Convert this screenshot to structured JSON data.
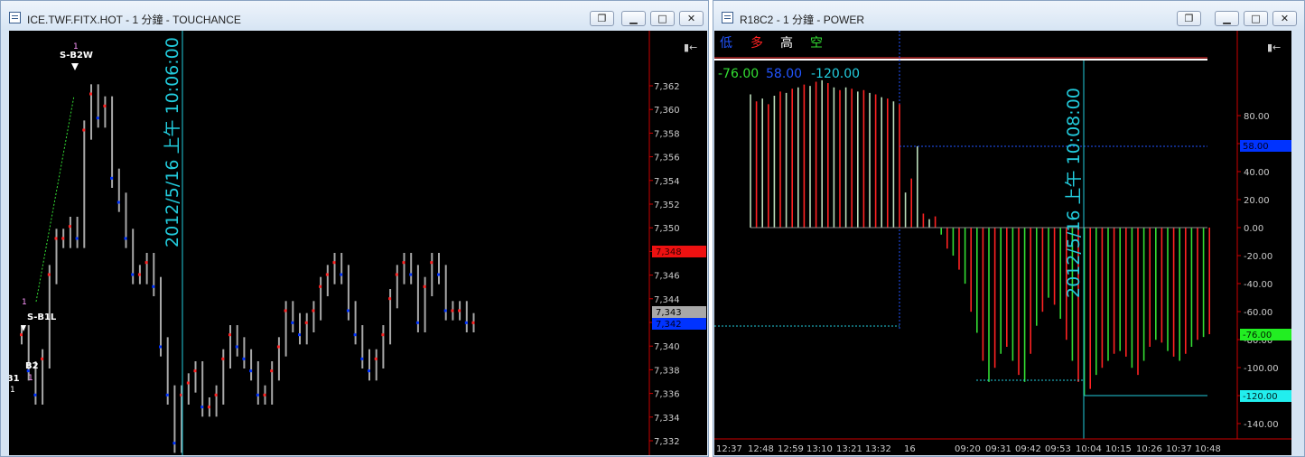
{
  "colors": {
    "bg": "#000000",
    "up": "#ff2222",
    "down": "#0033ff",
    "bar": "#a8a8a8",
    "cursor": "#22ccdd",
    "green": "#33dd33",
    "axis": "#cc0000"
  },
  "icons": {
    "window": "window-icon",
    "restore": "restore-icon",
    "minimize": "minimize-icon",
    "maximize": "maximize-icon",
    "close": "close-icon",
    "collapse": "collapse-icon"
  },
  "left_window": {
    "title": "ICE.TWF.FITX.HOT - 1 分鐘 - TOUCHANCE",
    "cursor_label": "2012/5/16 上午 10:06:00",
    "y_ticks": [
      "7,362",
      "7,360",
      "7,358",
      "7,356",
      "7,354",
      "7,352",
      "7,350",
      "7,348",
      "7,346",
      "7,344",
      "7,342",
      "7,340",
      "7,338",
      "7,336",
      "7,334",
      "7,332"
    ],
    "tag_red": "7,348",
    "tag_gray": "7,343",
    "tag_blue": "7,342",
    "marks": {
      "s_b2w": "S-B2W",
      "s_b1l": "S-B1L",
      "b2": "B2",
      "b1": "B1",
      "one": "1"
    }
  },
  "right_window": {
    "title": "R18C2 - 1 分鐘 - POWER",
    "legend": [
      "低",
      "多",
      "高",
      "空"
    ],
    "readouts": [
      "-76.00",
      "58.00",
      "-120.00"
    ],
    "y_ticks": [
      "80.00",
      "60.00",
      "40.00",
      "20.00",
      "0.00",
      "-20.00",
      "-40.00",
      "-60.00",
      "-80.00",
      "-100.00",
      "-120.00",
      "-140.00"
    ],
    "cursor_label": "2012/5/16 上午 10:08:00",
    "tag_green": "-76.00",
    "tag_blue": "58.00",
    "tag_cyan": "-120.00",
    "x_labels": [
      "12:37",
      "12:48",
      "12:59",
      "13:10",
      "13:21",
      "13:32",
      "16",
      "09:20",
      "09:31",
      "09:42",
      "09:53",
      "10:04",
      "10:15",
      "10:26",
      "10:37",
      "10:48"
    ]
  },
  "chart_data": [
    {
      "type": "bar",
      "title": "ICE.TWF.FITX.HOT - 1 分鐘 - TOUCHANCE",
      "ylim": [
        7331,
        7364
      ],
      "series": [
        {
          "values": [
            7341,
            7338,
            7336,
            7339,
            7346,
            7349,
            7349,
            7350,
            7349,
            7358,
            7361,
            7359,
            7360,
            7354,
            7352,
            7349,
            7346,
            7346,
            7347,
            7345,
            7340,
            7336,
            7332,
            7336,
            7337,
            7338,
            7335,
            7335,
            7336,
            7339,
            7341,
            7340,
            7339,
            7338,
            7336,
            7336,
            7338,
            7340,
            7343,
            7342,
            7341,
            7342,
            7343,
            7345,
            7346,
            7347,
            7346,
            7343,
            7341,
            7339,
            7338,
            7339,
            7341,
            7344,
            7346,
            7347,
            7346,
            7342,
            7345,
            7347,
            7346,
            7343,
            7343,
            7343,
            7342,
            7342
          ]
        }
      ]
    },
    {
      "type": "bar",
      "title": "R18C2 - 1 分鐘 - POWER",
      "ylim": [
        -150,
        110
      ],
      "series": [
        {
          "values": [
            95,
            90,
            92,
            88,
            94,
            97,
            96,
            99,
            100,
            102,
            101,
            104,
            105,
            103,
            100,
            98,
            100,
            99,
            97,
            98,
            96,
            95,
            93,
            92,
            90,
            88,
            25,
            35,
            58,
            10,
            6,
            8,
            -5,
            -15,
            -20,
            -30,
            -40,
            -60,
            -75,
            -95,
            -110,
            -100,
            -90,
            -85,
            -95,
            -105,
            -110,
            -90,
            -70,
            -60,
            -50,
            -55,
            -65,
            -80,
            -95,
            -110,
            -120,
            -115,
            -105,
            -100,
            -95,
            -90,
            -88,
            -92,
            -100,
            -105,
            -95,
            -85,
            -80,
            -82,
            -88,
            -92,
            -95,
            -90,
            -85,
            -80,
            -78,
            -76
          ]
        }
      ]
    }
  ]
}
